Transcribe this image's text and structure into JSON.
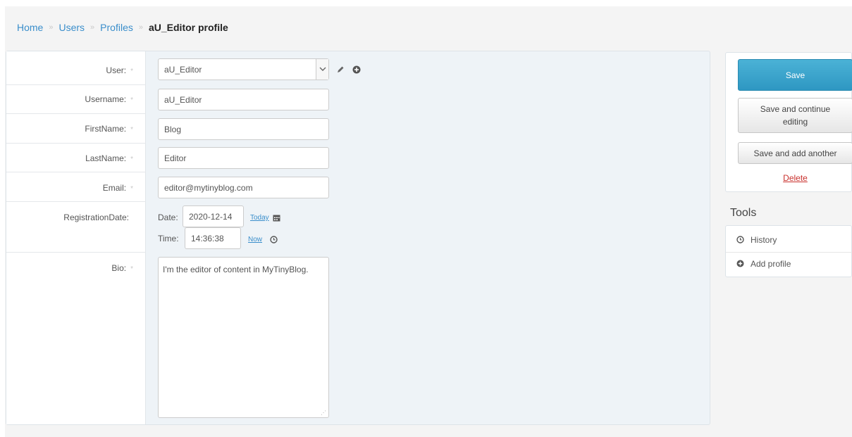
{
  "breadcrumb": {
    "home": "Home",
    "users": "Users",
    "profiles": "Profiles",
    "current": "aU_Editor profile",
    "separator": "»"
  },
  "form": {
    "user": {
      "label": "User:",
      "value": "aU_Editor",
      "required_mark": "*"
    },
    "username": {
      "label": "Username:",
      "value": "aU_Editor",
      "required_mark": "*"
    },
    "firstname": {
      "label": "FirstName:",
      "value": "Blog",
      "required_mark": "*"
    },
    "lastname": {
      "label": "LastName:",
      "value": "Editor",
      "required_mark": "*"
    },
    "email": {
      "label": "Email:",
      "value": "editor@mytinyblog.com",
      "required_mark": "*"
    },
    "registration": {
      "label": "RegistrationDate:",
      "date_label": "Date:",
      "date_value": "2020-12-14",
      "today_link": "Today",
      "time_label": "Time:",
      "time_value": "14:36:38",
      "now_link": "Now"
    },
    "bio": {
      "label": "Bio:",
      "value": "I'm the editor of content in MyTinyBlog.",
      "required_mark": "*"
    }
  },
  "actions": {
    "save": "Save",
    "save_continue": "Save and continue editing",
    "save_add": "Save and add another",
    "delete": "Delete"
  },
  "tools": {
    "title": "Tools",
    "items": [
      {
        "label": "History",
        "icon": "clock-icon"
      },
      {
        "label": "Add profile",
        "icon": "plus-circle-icon"
      }
    ]
  },
  "colors": {
    "link": "#3a8ecb",
    "primary_button": "#2e97c2",
    "delete": "#c9302c"
  }
}
